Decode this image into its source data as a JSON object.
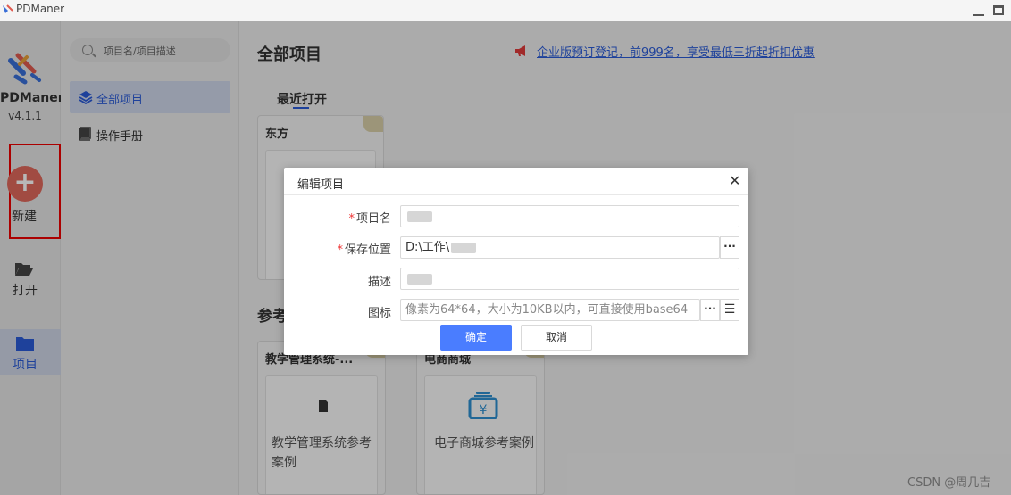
{
  "window": {
    "title": "PDManer"
  },
  "rail": {
    "brand": "PDManer",
    "version": "v4.1.1",
    "new_icon": "plus-icon",
    "new_label": "新建",
    "open_icon": "folder-open-icon",
    "open_label": "打开",
    "project_icon": "folder-icon",
    "project_label": "项目"
  },
  "sidebar": {
    "search_placeholder": "项目名/项目描述",
    "items": [
      {
        "icon": "layers-icon",
        "label": "全部项目",
        "active": true
      },
      {
        "icon": "book-icon",
        "label": "操作手册",
        "active": false
      }
    ]
  },
  "main": {
    "heading": "全部项目",
    "promo_icon": "megaphone-icon",
    "promo_text": "企业版预订登记，前999名，享受最低三折起折扣优惠",
    "recent_label": "最近打开",
    "recent_cards": [
      {
        "title": "东方"
      }
    ],
    "ref_heading": "参考",
    "ref_cards": [
      {
        "title": "教学管理系统-...",
        "icon": "file-icon",
        "text_line1": "教学管理系统参考",
        "text_line2": "案例"
      },
      {
        "title": "电商商城",
        "icon": "cash-register-icon",
        "text_line1": "电子商城参考案例",
        "text_line2": ""
      }
    ]
  },
  "dialog": {
    "title": "编辑项目",
    "close_icon": "close-icon",
    "fields": {
      "name_label": "项目名",
      "name_value": "",
      "path_label": "保存位置",
      "path_value": "D:\\工作\\",
      "desc_label": "描述",
      "desc_value": "",
      "icon_label": "图标",
      "icon_placeholder": "像素为64*64，大小为10KB以内，可直接使用base64"
    },
    "ok_label": "确定",
    "cancel_label": "取消"
  },
  "watermark": "CSDN @周几吉",
  "colors": {
    "accent": "#4a7dff",
    "link": "#2a5bd7",
    "danger": "#e00000",
    "new_button": "#e0685c"
  }
}
